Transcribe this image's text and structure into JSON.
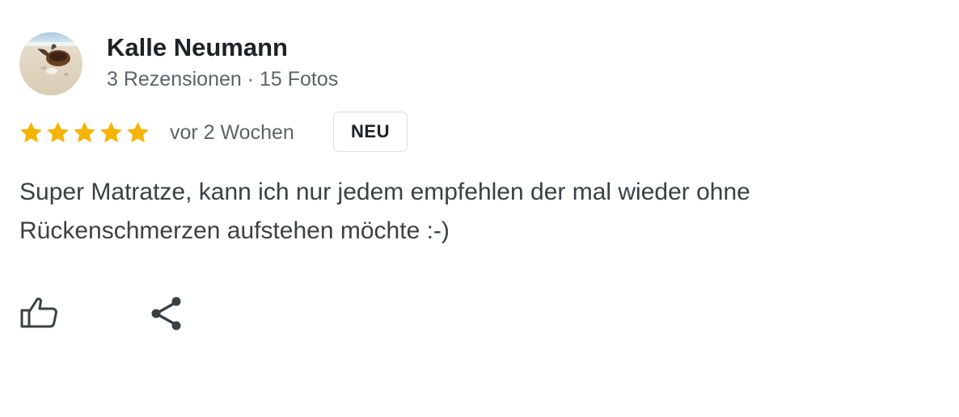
{
  "reviewer": {
    "name": "Kalle Neumann",
    "meta": "3 Rezensionen · 15 Fotos",
    "avatar_icon": "beach-shell-avatar"
  },
  "rating": {
    "stars": 5,
    "max": 5,
    "star_color": "#f4b400"
  },
  "review": {
    "date": "vor 2 Wochen",
    "badge": "NEU",
    "text": "Super Matratze, kann ich nur jedem empfehlen der mal wieder ohne Rückenschmerzen aufstehen möchte :-)"
  },
  "actions": {
    "like_icon": "thumbs-up-icon",
    "share_icon": "share-icon",
    "icon_color": "#3c4043"
  }
}
